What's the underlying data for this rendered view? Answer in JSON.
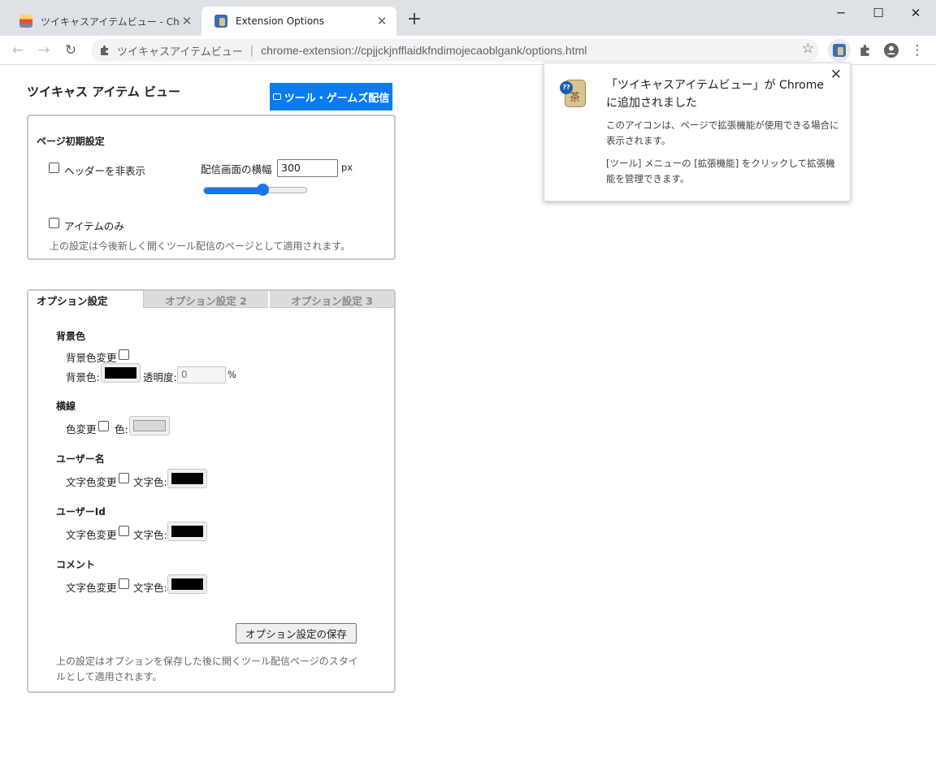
{
  "browser": {
    "tabs": [
      {
        "title": "ツイキャスアイテムビュー - Chrome ウェブストア",
        "active": false
      },
      {
        "title": "Extension Options",
        "active": true
      }
    ],
    "new_tab_symbol": "+",
    "window_controls": {
      "minimize": "─",
      "maximize": "☐",
      "close": "✕"
    },
    "toolbar": {
      "back": "←",
      "forward": "→",
      "reload": "↻",
      "ext_name": "ツイキャスアイテムビュー",
      "separator": "|",
      "url": "chrome-extension://cpjjckjnfflaidkfndimojecaoblgank/options.html",
      "bookmark_icon": "☆",
      "menu_icon": "⋮"
    }
  },
  "page": {
    "title": "ツイキャス アイテム ビュー",
    "broadcast_button": "ツール・ゲームズ配信",
    "initial": {
      "heading": "ページ初期設定",
      "hide_header_label": "ヘッダーを非表示",
      "width_label": "配信画面の横幅",
      "width_value": "300",
      "width_unit": "px",
      "slider_level_percent": 57,
      "items_only_label": "アイテムのみ",
      "note": "上の設定は今後新しく開くツール配信のページとして適用されます。"
    },
    "option_tabs": [
      "オプション設定",
      "オプション設定 2",
      "オプション設定 3"
    ],
    "options": {
      "bg_heading": "背景色",
      "bg_change_label": "背景色変更",
      "bg_color_label": "背景色:",
      "opacity_label": "透明度:",
      "opacity_value": "0",
      "opacity_unit": "%",
      "line_heading": "横線",
      "line_change_label": "色変更",
      "line_color_label": "色:",
      "user_name_heading": "ユーザー名",
      "user_id_heading": "ユーザーId",
      "comment_heading": "コメント",
      "text_color_change_label": "文字色変更",
      "text_color_label": "文字色:",
      "save_button": "オプション設定の保存",
      "note": "上の設定はオプションを保存した後に開くツール配信ページのスタイルとして適用されます。"
    }
  },
  "popup": {
    "title": "「ツイキャスアイテムビュー」が Chrome に追加されました",
    "close_symbol": "✕",
    "line1": "このアイコンは、ページで拡張機能が使用できる場合に表示されます。",
    "line2": "[ツール] メニューの [拡張機能] をクリックして拡張機能を管理できます。"
  },
  "colors": {
    "accent": "#0a7cf2",
    "swatch_black": "#000000",
    "swatch_line": "#d9d9d9"
  }
}
